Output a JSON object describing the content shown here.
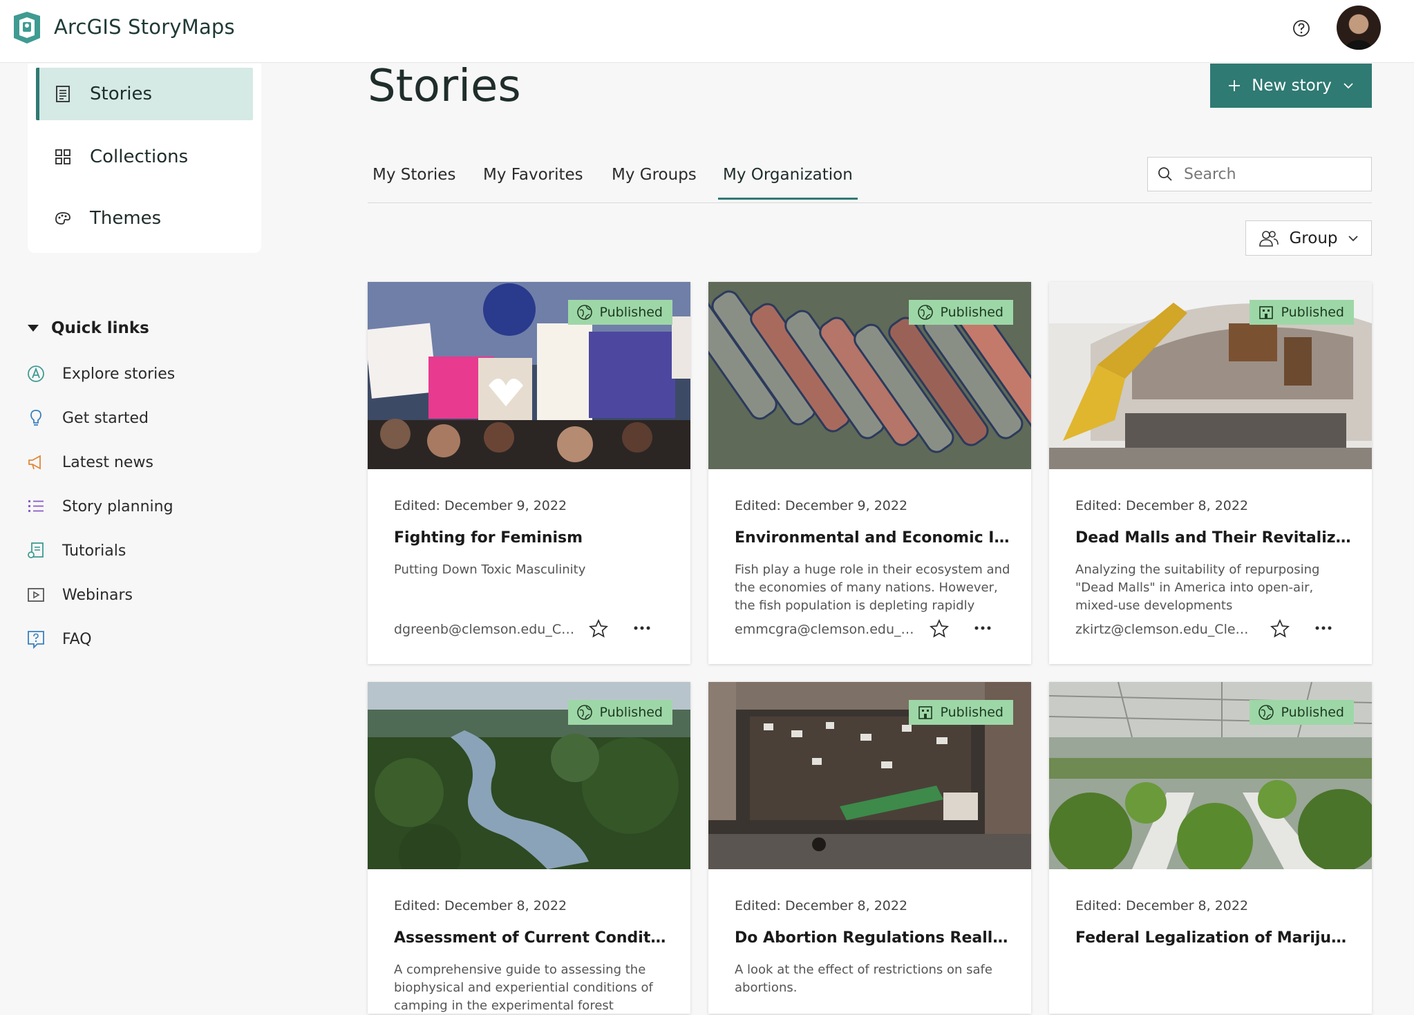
{
  "header": {
    "app_title": "ArcGIS StoryMaps"
  },
  "colors": {
    "accent": "#2f7a73",
    "badge": "#9ed7a7",
    "nav_active": "#d5e9e5"
  },
  "sidebar": {
    "items": [
      {
        "label": "Stories",
        "icon": "document-icon",
        "active": true
      },
      {
        "label": "Collections",
        "icon": "grid-icon",
        "active": false
      },
      {
        "label": "Themes",
        "icon": "palette-icon",
        "active": false
      }
    ],
    "quick_links_title": "Quick links",
    "quick_links": [
      {
        "label": "Explore stories",
        "icon": "compass-icon"
      },
      {
        "label": "Get started",
        "icon": "lightbulb-icon"
      },
      {
        "label": "Latest news",
        "icon": "megaphone-icon"
      },
      {
        "label": "Story planning",
        "icon": "list-icon"
      },
      {
        "label": "Tutorials",
        "icon": "tutorial-icon"
      },
      {
        "label": "Webinars",
        "icon": "play-icon"
      },
      {
        "label": "FAQ",
        "icon": "question-icon"
      }
    ]
  },
  "main": {
    "title": "Stories",
    "new_story_label": "New story",
    "tabs": [
      {
        "label": "My Stories",
        "active": false
      },
      {
        "label": "My Favorites",
        "active": false
      },
      {
        "label": "My Groups",
        "active": false
      },
      {
        "label": "My Organization",
        "active": true
      }
    ],
    "search_placeholder": "Search",
    "filter_label": "Group"
  },
  "cards": [
    {
      "status": "Published",
      "status_icon": "globe-icon",
      "edited": "Edited: December 9, 2022",
      "title": "Fighting for Feminism",
      "description": "Putting Down Toxic Masculinity",
      "author": "dgreenb@clemson.edu_Clemson",
      "image": "protest-crowd"
    },
    {
      "status": "Published",
      "status_icon": "globe-icon",
      "edited": "Edited: December 9, 2022",
      "title": "Environmental and Economic Impacts of Overfishing",
      "description": "Fish play a huge role in their ecosystem and the economies of many nations. However, the fish population is depleting rapidly",
      "author": "emmcgra@clemson.edu_Clemson",
      "image": "fishing-boats"
    },
    {
      "status": "Published",
      "status_icon": "organization-icon",
      "edited": "Edited: December 8, 2022",
      "title": "Dead Malls and Their Revitalization",
      "description": "Analyzing the suitability of repurposing \"Dead Malls\" in America into open-air, mixed-use developments",
      "author": "zkirtz@clemson.edu_Clemson",
      "image": "demolished-mall"
    },
    {
      "status": "Published",
      "status_icon": "globe-icon",
      "edited": "Edited: December 8, 2022",
      "title": "Assessment of Current Conditions",
      "description": "A comprehensive guide to assessing the biophysical and experiential conditions of camping in the experimental forest",
      "author": "",
      "image": "forest-lake"
    },
    {
      "status": "Published",
      "status_icon": "organization-icon",
      "edited": "Edited: December 8, 2022",
      "title": "Do Abortion Regulations Really Reduce Abortions?",
      "description": "A look at the effect of restrictions on safe abortions.",
      "author": "",
      "image": "march-crowd"
    },
    {
      "status": "Published",
      "status_icon": "globe-icon",
      "edited": "Edited: December 8, 2022",
      "title": "Federal Legalization of Marijuana",
      "description": "",
      "author": "",
      "image": "greenhouse-plants"
    }
  ]
}
